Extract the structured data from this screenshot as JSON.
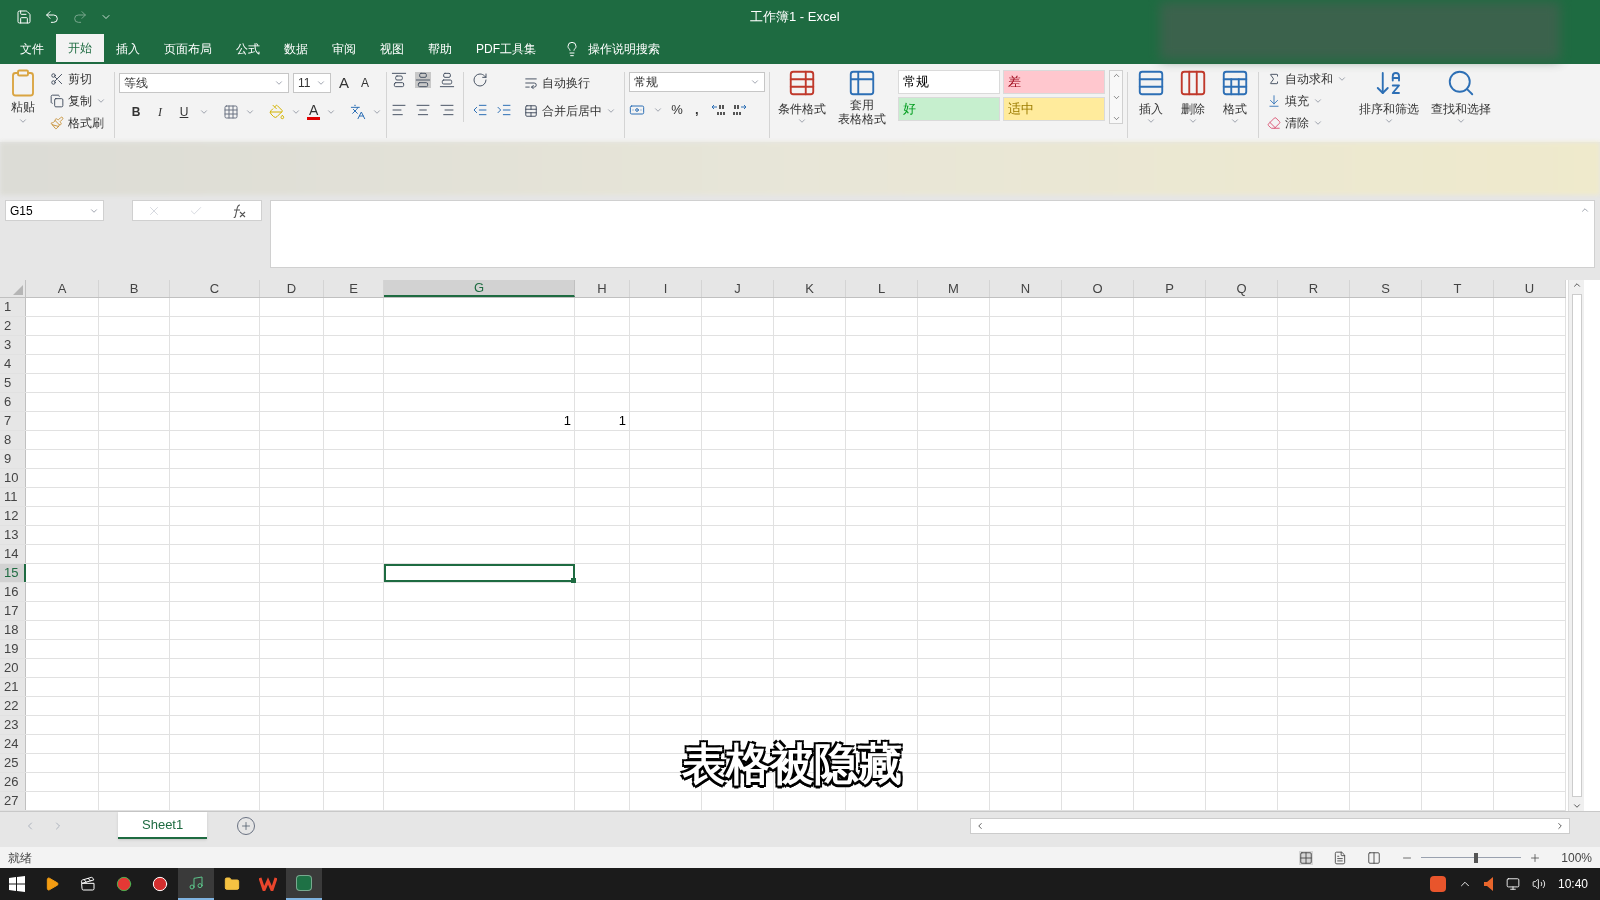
{
  "title_bar": {
    "title": "工作簿1  -  Excel"
  },
  "menu_tabs": [
    {
      "label": "文件",
      "selected": false
    },
    {
      "label": "开始",
      "selected": true
    },
    {
      "label": "插入",
      "selected": false
    },
    {
      "label": "页面布局",
      "selected": false
    },
    {
      "label": "公式",
      "selected": false
    },
    {
      "label": "数据",
      "selected": false
    },
    {
      "label": "审阅",
      "selected": false
    },
    {
      "label": "视图",
      "selected": false
    },
    {
      "label": "帮助",
      "selected": false
    },
    {
      "label": "PDF工具集",
      "selected": false
    }
  ],
  "tell_me": "操作说明搜索",
  "ribbon": {
    "clipboard": {
      "paste": "粘贴",
      "cut": "剪切",
      "copy": "复制",
      "format_painter": "格式刷"
    },
    "font": {
      "name": "等线",
      "size": "11",
      "grow": "A",
      "shrink": "A",
      "bold": "B",
      "italic": "I",
      "underline": "U",
      "font_color": "A"
    },
    "alignment": {
      "wrap_text": "自动换行",
      "merge_center": "合并后居中"
    },
    "number": {
      "format": "常规",
      "percent": "%",
      "comma": ","
    },
    "styles": {
      "conditional_format": "条件格式",
      "format_as_table": [
        "套用",
        "表格格式"
      ],
      "cell_styles": [
        {
          "label": "常规",
          "color": "#ffffff"
        },
        {
          "label": "差",
          "color": "#ffc7ce"
        },
        {
          "label": "好",
          "color": "#c6efce"
        },
        {
          "label": "适中",
          "color": "#ffeb9c"
        }
      ]
    },
    "cells": {
      "insert": "插入",
      "delete": "删除",
      "format": "格式"
    },
    "editing": {
      "autosum": "自动求和",
      "fill": "填充",
      "clear": "清除",
      "sort_filter": "排序和筛选",
      "find_select": "查找和选择"
    }
  },
  "formula_bar": {
    "name_box": "G15"
  },
  "sheet": {
    "columns": [
      {
        "label": "A",
        "selected": false
      },
      {
        "label": "B",
        "selected": false
      },
      {
        "label": "C",
        "selected": false
      },
      {
        "label": "D",
        "selected": false
      },
      {
        "label": "E",
        "selected": false
      },
      {
        "label": "G",
        "selected": true
      },
      {
        "label": "H",
        "selected": false
      },
      {
        "label": "I",
        "selected": false
      },
      {
        "label": "J",
        "selected": false
      },
      {
        "label": "K",
        "selected": false
      },
      {
        "label": "L",
        "selected": false
      },
      {
        "label": "M",
        "selected": false
      },
      {
        "label": "N",
        "selected": false
      },
      {
        "label": "O",
        "selected": false
      },
      {
        "label": "P",
        "selected": false
      },
      {
        "label": "Q",
        "selected": false
      },
      {
        "label": "R",
        "selected": false
      },
      {
        "label": "S",
        "selected": false
      },
      {
        "label": "T",
        "selected": false
      },
      {
        "label": "U",
        "selected": false
      }
    ],
    "rows": [
      {
        "label": "1",
        "selected": false
      },
      {
        "label": "2",
        "selected": false
      },
      {
        "label": "3",
        "selected": false
      },
      {
        "label": "4",
        "selected": false
      },
      {
        "label": "5",
        "selected": false
      },
      {
        "label": "6",
        "selected": false
      },
      {
        "label": "7",
        "selected": false,
        "cells": [
          null,
          null,
          null,
          null,
          null,
          "1",
          "1"
        ]
      },
      {
        "label": "8",
        "selected": false
      },
      {
        "label": "9",
        "selected": false
      },
      {
        "label": "10",
        "selected": false
      },
      {
        "label": "11",
        "selected": false
      },
      {
        "label": "12",
        "selected": false
      },
      {
        "label": "13",
        "selected": false
      },
      {
        "label": "14",
        "selected": false
      },
      {
        "label": "15",
        "selected": true
      },
      {
        "label": "16",
        "selected": false
      },
      {
        "label": "17",
        "selected": false
      },
      {
        "label": "18",
        "selected": false
      },
      {
        "label": "19",
        "selected": false
      },
      {
        "label": "20",
        "selected": false
      },
      {
        "label": "21",
        "selected": false
      },
      {
        "label": "22",
        "selected": false
      },
      {
        "label": "23",
        "selected": false
      },
      {
        "label": "24",
        "selected": false
      },
      {
        "label": "25",
        "selected": false
      },
      {
        "label": "26",
        "selected": false
      },
      {
        "label": "27",
        "selected": false
      }
    ]
  },
  "caption": "表格被隐藏",
  "sheet_tabs": [
    {
      "label": "Sheet1",
      "selected": true
    }
  ],
  "status_bar": {
    "status": "就绪",
    "zoom": "100%",
    "zoom_level": {
      "level": 0.55
    }
  },
  "taskbar": {
    "time": "10:40"
  }
}
